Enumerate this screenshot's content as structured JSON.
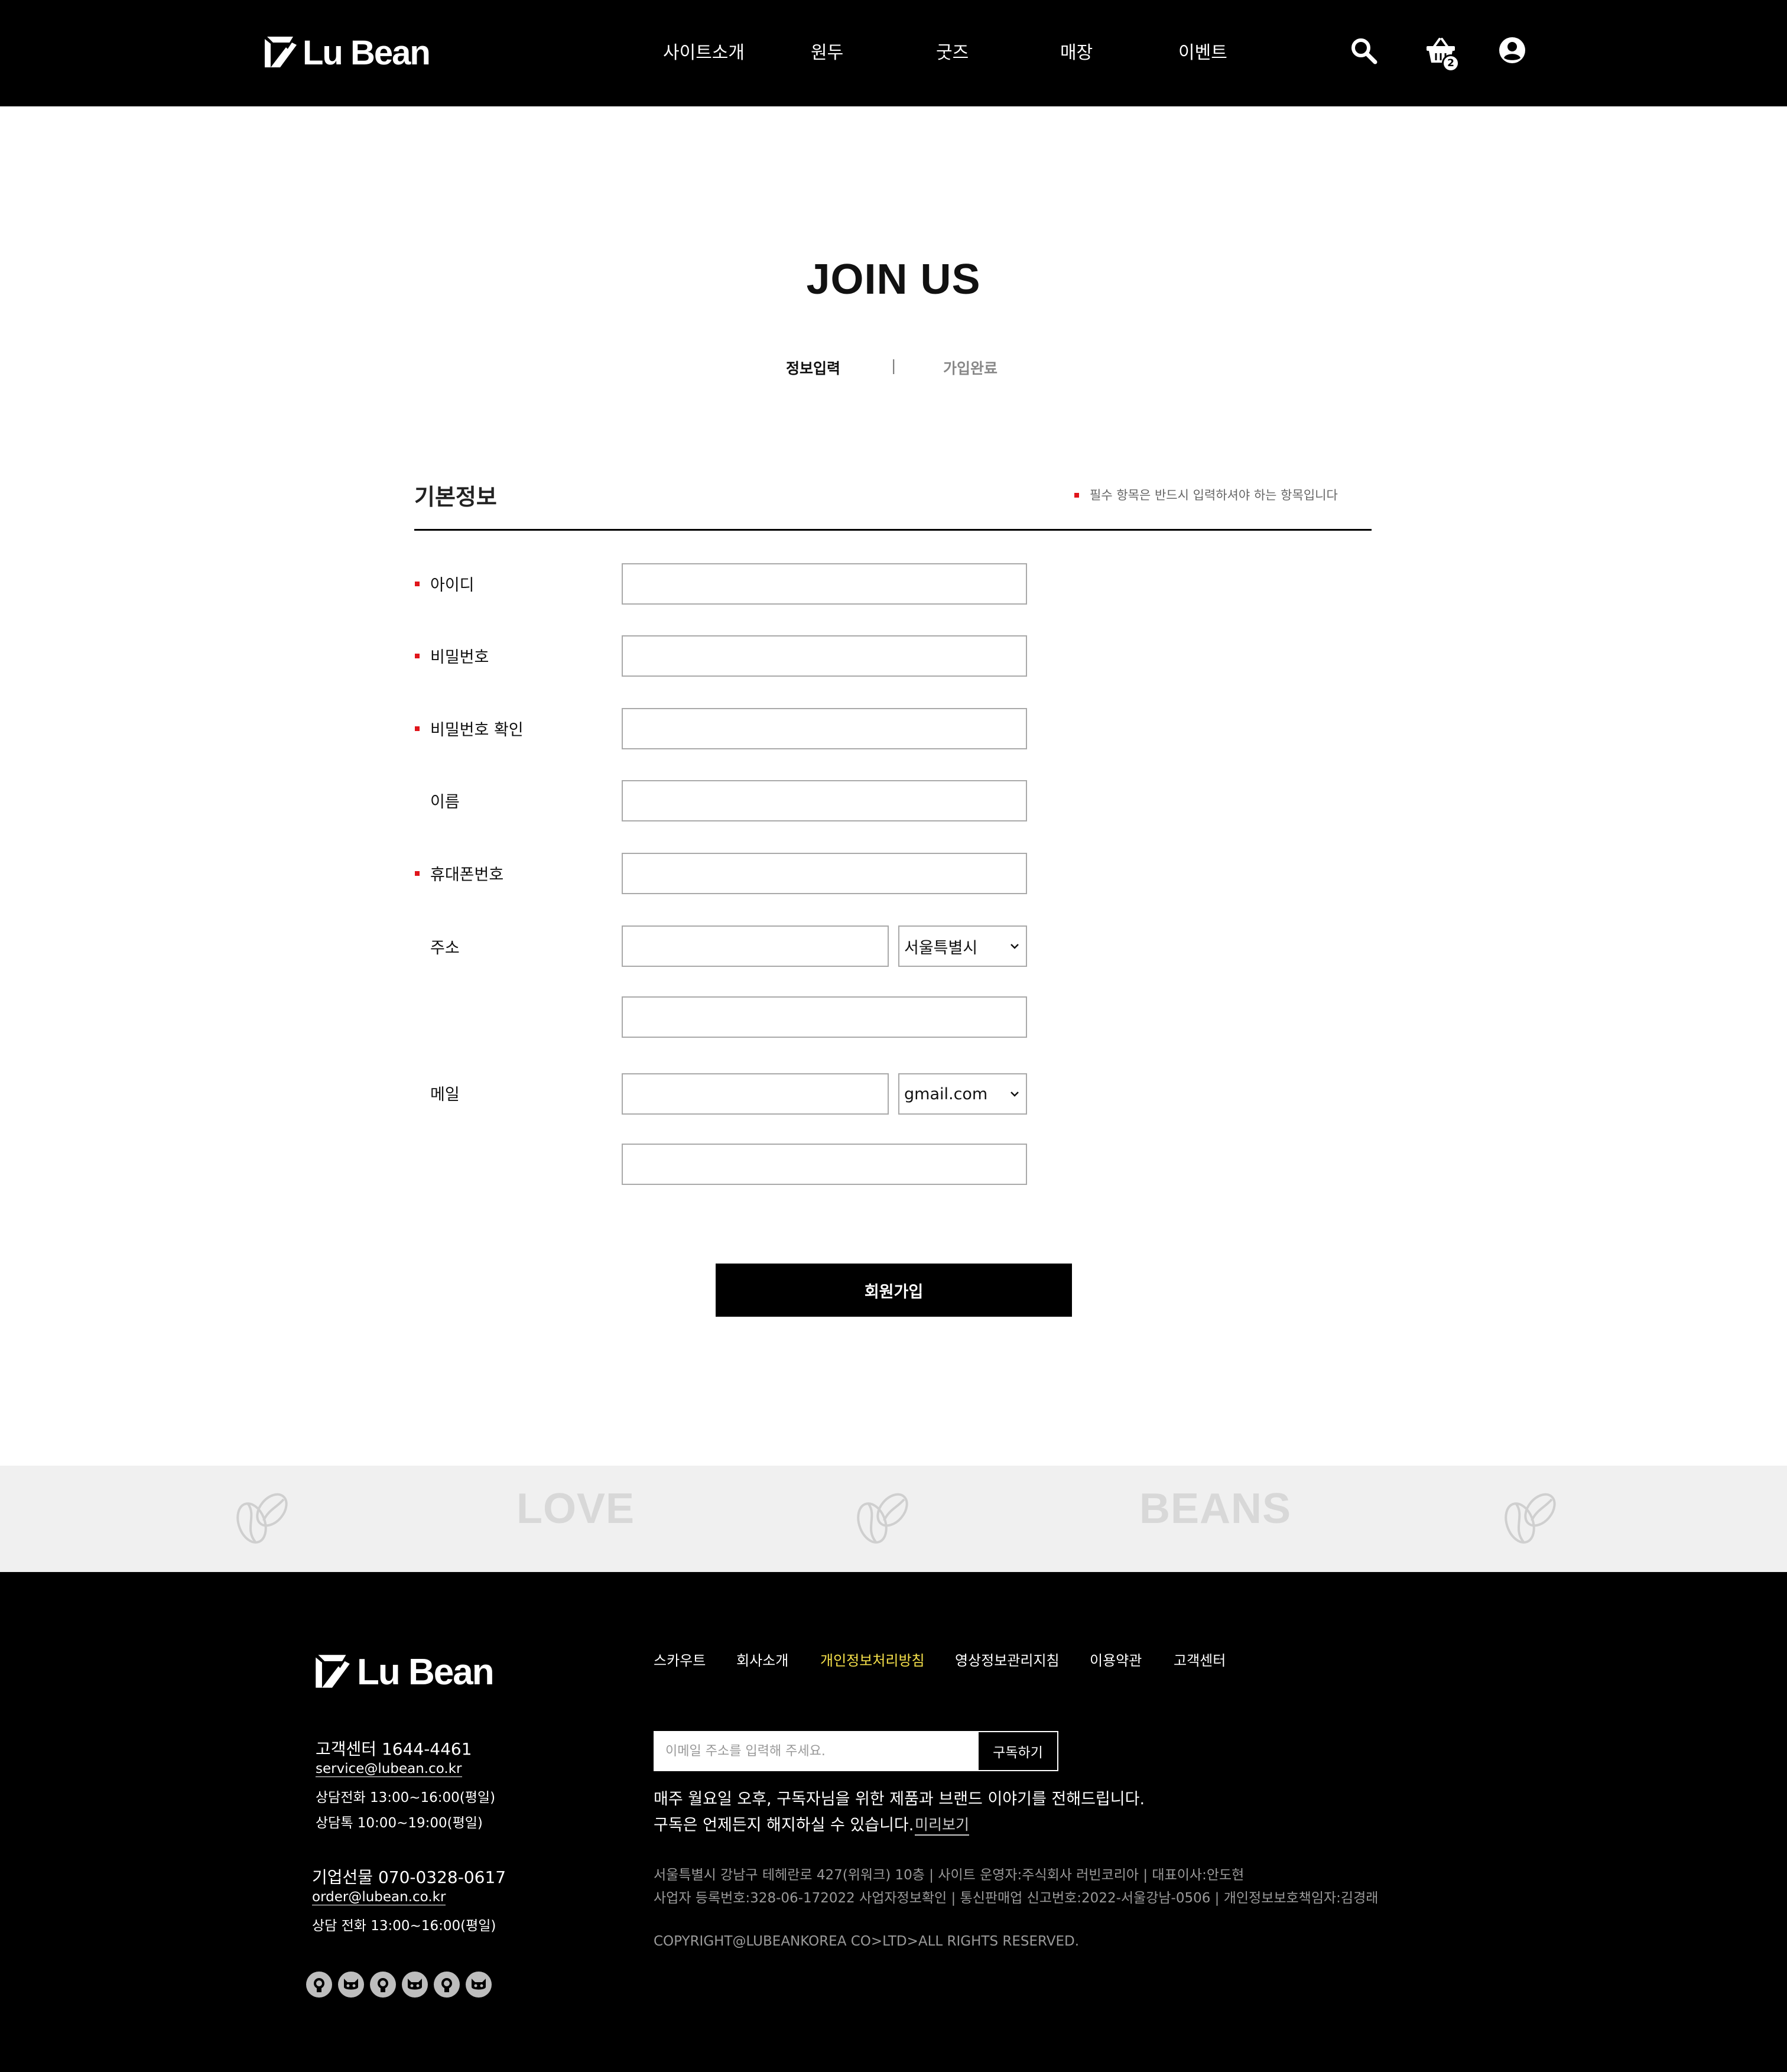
{
  "header": {
    "logo_text": "Lu Bean",
    "nav": [
      "사이트소개",
      "원두",
      "굿즈",
      "매장",
      "이벤트"
    ],
    "cart_count": "2"
  },
  "main": {
    "title": "JOIN US",
    "steps": {
      "current": "정보입력",
      "separator": "|",
      "next": "가입완료"
    },
    "section_title": "기본정보",
    "required_note": "필수 항목은 반드시 입력하셔야 하는 항목입니다",
    "fields": {
      "id": "아이디",
      "password": "비밀번호",
      "password_confirm": "비밀번호 확인",
      "name": "이름",
      "phone": "휴대폰번호",
      "address": "주소",
      "email": "메일"
    },
    "address_city": "서울특별시",
    "email_domain": "gmail.com",
    "submit_label": "회원가입"
  },
  "banner": {
    "words": [
      "LOVE",
      "BEANS"
    ]
  },
  "footer": {
    "logo_text": "Lu Bean",
    "links": [
      "스카우트",
      "회사소개",
      "개인정보처리방침",
      "영상정보관리지침",
      "이용약관",
      "고객센터"
    ],
    "cs": {
      "title": "고객센터 1644-4461",
      "email": "service@lubean.co.kr",
      "phone_hours": "상담전화 13:00~16:00(평일)",
      "talk_hours": "상담톡 10:00~19:00(평일)"
    },
    "corp": {
      "title": "기업선물 070-0328-0617",
      "email": "order@lubean.co.kr",
      "phone_hours": "상담 전화 13:00~16:00(평일)"
    },
    "subscribe": {
      "placeholder": "이메일 주소를 입력해 주세요.",
      "button": "구독하기",
      "desc1": "매주 월요일 오후, 구독자님을 위한 제품과 브랜드 이야기를 전해드립니다.",
      "desc2": "구독은 언제든지 해지하실 수 있습니다.",
      "preview": "미리보기"
    },
    "info1": "서울특별시 강남구 테헤란로 427(위워크) 10층 | 사이트 운영자:주식회사 러빈코리아 | 대표이사:안도현",
    "info2": "사업자 등록번호:328-06-172022 사업자정보확인 | 통신판매업 신고번호:2022-서울강남-0506 | 개인정보보호책임자:김경래",
    "copyright": "COPYRIGHT@LUBEANKOREA CO>LTD>ALL RIGHTS RESERVED."
  },
  "colors": {
    "required": "#e0151b",
    "highlight_link": "#f5e04a",
    "banner_bg": "#f0f0f0"
  }
}
